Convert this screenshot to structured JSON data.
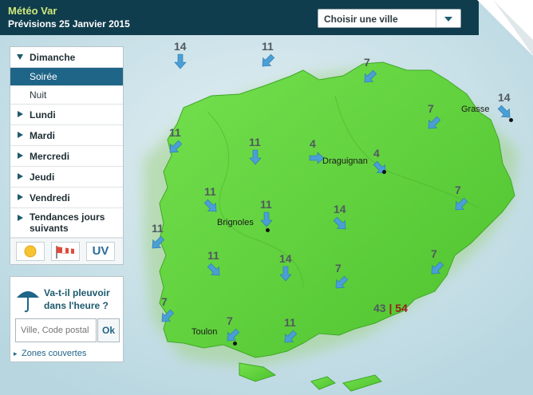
{
  "header": {
    "title": "Météo Var",
    "subtitle": "Prévisions 25 Janvier 2015"
  },
  "city_select": {
    "label": "Choisir une ville"
  },
  "days": [
    {
      "label": "Dimanche",
      "expanded": true,
      "subs": [
        "Soirée",
        "Nuit"
      ],
      "active_sub": "Soirée"
    },
    {
      "label": "Lundi"
    },
    {
      "label": "Mardi"
    },
    {
      "label": "Mercredi"
    },
    {
      "label": "Jeudi"
    },
    {
      "label": "Vendredi"
    },
    {
      "label": "Tendances jours suivants"
    }
  ],
  "icons": {
    "sun": "sun-icon",
    "wind": "windsock-icon",
    "uv": "UV"
  },
  "rain": {
    "question": "Va-t-il pleuvoir dans l'heure ?",
    "placeholder": "Ville, Code postal",
    "ok": "Ok",
    "zones": "Zones couvertes"
  },
  "cities": [
    {
      "name": "Grasse"
    },
    {
      "name": "Draguignan"
    },
    {
      "name": "Brignoles"
    },
    {
      "name": "Toulon"
    }
  ],
  "winds": [
    {
      "value": "14",
      "dir": "S"
    },
    {
      "value": "11",
      "dir": "SW"
    },
    {
      "value": "7",
      "dir": "SW"
    },
    {
      "value": "14",
      "dir": "SE"
    },
    {
      "value": "7",
      "dir": "SW"
    },
    {
      "value": "11",
      "dir": "SW"
    },
    {
      "value": "11",
      "dir": "S"
    },
    {
      "value": "4",
      "dir": "E"
    },
    {
      "value": "4",
      "dir": "SE"
    },
    {
      "value": "7",
      "dir": "SW"
    },
    {
      "value": "11",
      "dir": "SE"
    },
    {
      "value": "11",
      "dir": "S"
    },
    {
      "value": "14",
      "dir": "SE"
    },
    {
      "value": "11",
      "dir": "SW"
    },
    {
      "value": "11",
      "dir": "SE"
    },
    {
      "value": "14",
      "dir": "S"
    },
    {
      "value": "7",
      "dir": "SW"
    },
    {
      "value": "7",
      "dir": "SW"
    },
    {
      "value": "7",
      "dir": "SW"
    },
    {
      "value": "7",
      "dir": "SW"
    },
    {
      "value": "11",
      "dir": "SW"
    }
  ],
  "temperature": {
    "min": "43",
    "separator": "|",
    "max": "54"
  },
  "colors": {
    "land": "#5fd13a",
    "sea": "#bfe0ea",
    "arrow": "#4a9fd6",
    "header": "#0f3d4d",
    "accent": "#1f6587"
  }
}
